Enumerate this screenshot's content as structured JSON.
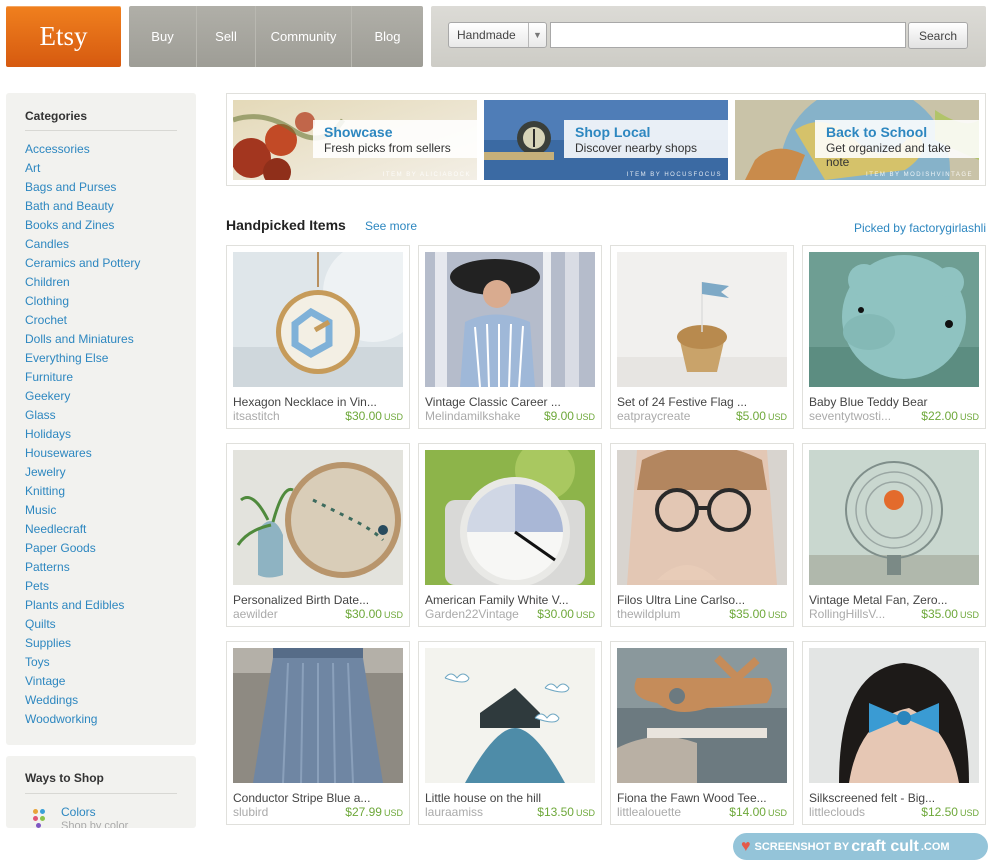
{
  "header": {
    "logo": "Etsy",
    "nav": [
      "Buy",
      "Sell",
      "Community",
      "Blog"
    ],
    "search": {
      "scope": "Handmade",
      "value": "",
      "button": "Search"
    }
  },
  "sidebar": {
    "categories_title": "Categories",
    "categories": [
      "Accessories",
      "Art",
      "Bags and Purses",
      "Bath and Beauty",
      "Books and Zines",
      "Candles",
      "Ceramics and Pottery",
      "Children",
      "Clothing",
      "Crochet",
      "Dolls and Miniatures",
      "Everything Else",
      "Furniture",
      "Geekery",
      "Glass",
      "Holidays",
      "Housewares",
      "Jewelry",
      "Knitting",
      "Music",
      "Needlecraft",
      "Paper Goods",
      "Patterns",
      "Pets",
      "Plants and Edibles",
      "Quilts",
      "Supplies",
      "Toys",
      "Vintage",
      "Weddings",
      "Woodworking"
    ],
    "ways_title": "Ways to Shop",
    "ways": [
      {
        "label": "Colors",
        "sub": "Shop by color",
        "icon": "color-dots-icon"
      }
    ]
  },
  "banners": [
    {
      "title": "Showcase",
      "subtitle": "Fresh picks from sellers",
      "credit": "ITEM BY ALICIABOCK"
    },
    {
      "title": "Shop Local",
      "subtitle": "Discover nearby shops",
      "credit": "ITEM BY HOCUSFOCUS"
    },
    {
      "title": "Back to School",
      "subtitle": "Get organized and take note",
      "credit": "ITEM BY MODISHVINTAGE"
    }
  ],
  "handpicked": {
    "title": "Handpicked Items",
    "see_more": "See more",
    "picked_by": "Picked by factorygirlashli",
    "items": [
      {
        "title": "Hexagon Necklace in Vin...",
        "seller": "itsastitch",
        "price": "$30.00",
        "currency": "USD"
      },
      {
        "title": "Vintage Classic Career ...",
        "seller": "Melindamilkshake",
        "price": "$9.00",
        "currency": "USD"
      },
      {
        "title": "Set of 24 Festive Flag ...",
        "seller": "eatpraycreate",
        "price": "$5.00",
        "currency": "USD"
      },
      {
        "title": "Baby Blue Teddy Bear",
        "seller": "seventytwosti...",
        "price": "$22.00",
        "currency": "USD"
      },
      {
        "title": "Personalized Birth Date...",
        "seller": "aewilder",
        "price": "$30.00",
        "currency": "USD"
      },
      {
        "title": "American Family White V...",
        "seller": "Garden22Vintage",
        "price": "$30.00",
        "currency": "USD"
      },
      {
        "title": "Filos Ultra Line Carlso...",
        "seller": "thewildplum",
        "price": "$35.00",
        "currency": "USD"
      },
      {
        "title": "Vintage Metal Fan, Zero...",
        "seller": "RollingHillsV...",
        "price": "$35.00",
        "currency": "USD"
      },
      {
        "title": "Conductor Stripe Blue a...",
        "seller": "slubird",
        "price": "$27.99",
        "currency": "USD"
      },
      {
        "title": "Little house on the hill",
        "seller": "lauraamiss",
        "price": "$13.50",
        "currency": "USD"
      },
      {
        "title": "Fiona the Fawn Wood Tee...",
        "seller": "littlealouette",
        "price": "$14.00",
        "currency": "USD"
      },
      {
        "title": "Silkscreened felt - Big...",
        "seller": "littleclouds",
        "price": "$12.50",
        "currency": "USD"
      }
    ]
  },
  "watermark": {
    "prefix": "SCREENSHOT BY",
    "brand": "craft cult",
    "suffix": ".COM"
  },
  "colors": {
    "logo_orange": "#e8701a",
    "nav_gray": "#a8a7a0",
    "link_blue": "#2d87c0",
    "price_green": "#6ea83a",
    "sidebar_bg": "#f2f2ef"
  }
}
